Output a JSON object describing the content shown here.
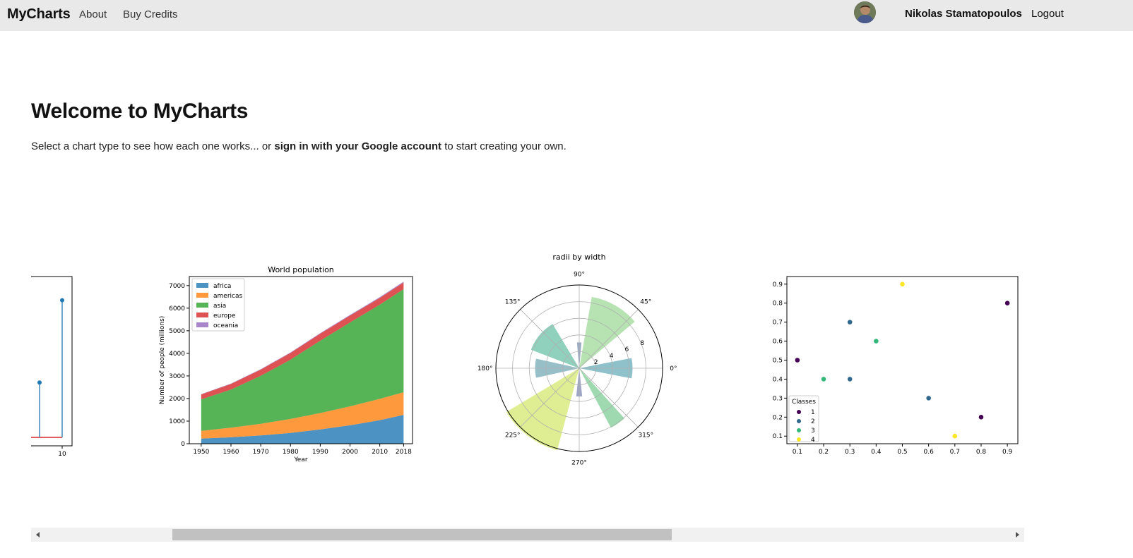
{
  "nav": {
    "brand": "MyCharts",
    "links": [
      "About",
      "Buy Credits"
    ],
    "user_name": "Nikolas Stamatopoulos",
    "logout": "Logout"
  },
  "main": {
    "title": "Welcome to MyCharts",
    "intro_before": "Select a chart type to see how each one works... or ",
    "intro_link": "sign in with your Google account",
    "intro_after": " to start creating your own."
  },
  "chart_data": [
    {
      "type": "stem",
      "partially_visible": true,
      "x_ticks_visible": [
        "10"
      ],
      "points": [
        {
          "x": 8,
          "y": 3.6
        },
        {
          "x": 10,
          "y": 9.0
        }
      ],
      "baseline_color": "#d62728",
      "stem_color": "#1f77b4"
    },
    {
      "type": "area",
      "stacked": true,
      "title": "World population",
      "xlabel": "Year",
      "ylabel": "Number of people (millions)",
      "x": [
        1950,
        1960,
        1970,
        1980,
        1990,
        2000,
        2010,
        2018
      ],
      "xlim": [
        1946,
        2021
      ],
      "ylim": [
        0,
        7400
      ],
      "yticks": [
        0,
        1000,
        2000,
        3000,
        4000,
        5000,
        6000,
        7000
      ],
      "legend": "upper-left",
      "series": [
        {
          "name": "africa",
          "color": "#1f77b4",
          "values": [
            228,
            284,
            365,
            477,
            631,
            814,
            1044,
            1275
          ]
        },
        {
          "name": "americas",
          "color": "#ff7f0e",
          "values": [
            340,
            425,
            519,
            619,
            727,
            840,
            943,
            1006
          ]
        },
        {
          "name": "asia",
          "color": "#2ca02c",
          "values": [
            1394,
            1686,
            2120,
            2625,
            3202,
            3714,
            4169,
            4560
          ]
        },
        {
          "name": "europe",
          "color": "#d62728",
          "values": [
            220,
            253,
            276,
            295,
            310,
            303,
            294,
            293
          ]
        },
        {
          "name": "oceania",
          "color": "#9467bd",
          "values": [
            12,
            15,
            19,
            22,
            26,
            31,
            36,
            39
          ]
        }
      ]
    },
    {
      "type": "polar_bar",
      "title": "radii by width",
      "angle_labels": [
        "0°",
        "45°",
        "90°",
        "135°",
        "180°",
        "225°",
        "270°",
        "315°"
      ],
      "radial_ticks": [
        "2",
        "4",
        "6",
        "8"
      ],
      "rmax": 10,
      "bars": [
        {
          "theta_deg": 0,
          "width_deg": 22,
          "radius": 6.4,
          "color": "#68acb8"
        },
        {
          "theta_deg": 60,
          "width_deg": 40,
          "radius": 8.7,
          "color": "#9fd99a"
        },
        {
          "theta_deg": 90,
          "width_deg": 10,
          "radius": 3.1,
          "color": "#7b8fb0"
        },
        {
          "theta_deg": 140,
          "width_deg": 38,
          "radius": 6.2,
          "color": "#69c2a5"
        },
        {
          "theta_deg": 180,
          "width_deg": 25,
          "radius": 5.3,
          "color": "#74aab5"
        },
        {
          "theta_deg": 233,
          "width_deg": 44,
          "radius": 10.2,
          "color": "#d6e86f"
        },
        {
          "theta_deg": 270,
          "width_deg": 12,
          "radius": 3.4,
          "color": "#7b88b0"
        },
        {
          "theta_deg": 305,
          "width_deg": 14,
          "radius": 8.1,
          "color": "#7dcc96"
        }
      ]
    },
    {
      "type": "scatter",
      "xlim": [
        0.06,
        0.94
      ],
      "ylim": [
        0.06,
        0.94
      ],
      "xticks": [
        0.1,
        0.2,
        0.3,
        0.4,
        0.5,
        0.6,
        0.7,
        0.8,
        0.9
      ],
      "yticks": [
        0.1,
        0.2,
        0.3,
        0.4,
        0.5,
        0.6,
        0.7,
        0.8,
        0.9
      ],
      "legend_title": "Classes",
      "legend": "lower-left",
      "classes": [
        {
          "label": "1",
          "color": "#440154"
        },
        {
          "label": "2",
          "color": "#31688e"
        },
        {
          "label": "3",
          "color": "#35b779"
        },
        {
          "label": "4",
          "color": "#fde725"
        }
      ],
      "points": [
        {
          "x": 0.1,
          "y": 0.5,
          "c": "1"
        },
        {
          "x": 0.2,
          "y": 0.4,
          "c": "3"
        },
        {
          "x": 0.3,
          "y": 0.7,
          "c": "2"
        },
        {
          "x": 0.3,
          "y": 0.4,
          "c": "2"
        },
        {
          "x": 0.4,
          "y": 0.6,
          "c": "3"
        },
        {
          "x": 0.5,
          "y": 0.9,
          "c": "4"
        },
        {
          "x": 0.6,
          "y": 0.3,
          "c": "2"
        },
        {
          "x": 0.7,
          "y": 0.1,
          "c": "4"
        },
        {
          "x": 0.8,
          "y": 0.2,
          "c": "1"
        },
        {
          "x": 0.9,
          "y": 0.8,
          "c": "1"
        }
      ]
    }
  ]
}
